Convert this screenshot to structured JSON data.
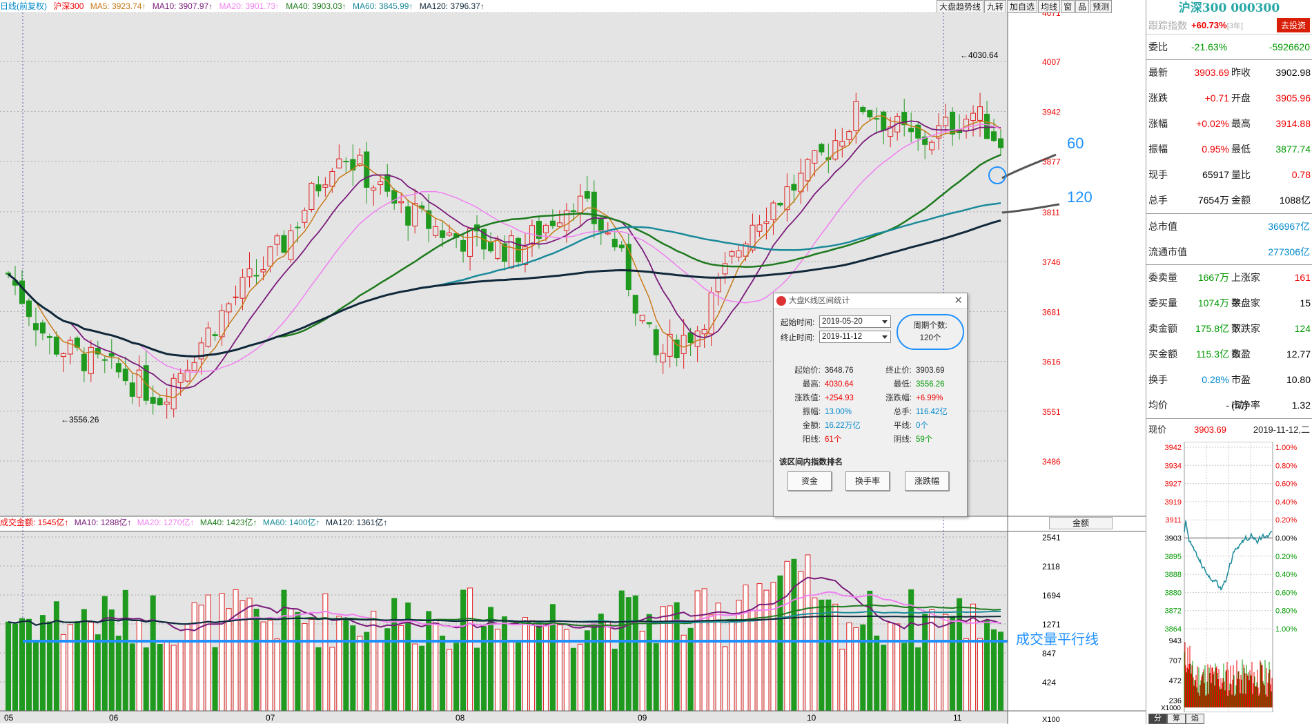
{
  "legend_main": {
    "title": "日线(前复权)",
    "index": "沪深300",
    "ma5": "MA5: 3923.74↑",
    "ma10": "MA10: 3907.97↑",
    "ma20": "MA20: 3901.73↑",
    "ma40": "MA40: 3903.03↑",
    "ma60": "MA60: 3845.99↑",
    "ma120": "MA120: 3796.37↑"
  },
  "toolbar": {
    "btn1": "大盘趋势线",
    "btn2": "九转",
    "btn3": "加自选",
    "btn4": "均线",
    "btn5": "窗",
    "btn6": "品",
    "btn7": "预测"
  },
  "legend_vol": {
    "title": "成交金额: 1545亿↑",
    "ma10": "MA10: 1288亿↑",
    "ma20": "MA20: 1270亿↑",
    "ma40": "MA40: 1423亿↑",
    "ma60": "MA60: 1400亿↑",
    "ma120": "MA120: 1361亿↑",
    "selector": "金额"
  },
  "price_axis": [
    "4071",
    "4007",
    "3942",
    "3877",
    "3811",
    "3746",
    "3681",
    "3616",
    "3551",
    "3486"
  ],
  "vol_axis": [
    "2541",
    "2118",
    "1694",
    "1271",
    "847",
    "424"
  ],
  "vol_unit": "X100",
  "month_labels": [
    "05",
    "06",
    "07",
    "08",
    "09",
    "10",
    "11"
  ],
  "high_marker": "4030.64",
  "low_marker": "3556.26",
  "annotations": {
    "a60": "60",
    "a120": "120",
    "vol_line": "成交量平行线"
  },
  "dialog": {
    "title": "大盘K线区间统计",
    "start_label": "起始时间:",
    "start": "2019-05-20",
    "end_label": "终止时间:",
    "end": "2019-11-12",
    "period_label": "周期个数:",
    "period": "120个",
    "stats": [
      [
        "起始价:",
        "3648.76",
        "终止价:",
        "3903.69"
      ],
      [
        "最高:",
        "4030.64",
        "最低:",
        "3556.26"
      ],
      [
        "涨跌值:",
        "+254.93",
        "涨跌幅:",
        "+6.99%"
      ],
      [
        "振幅:",
        "13.00%",
        "总手:",
        "116.42亿"
      ],
      [
        "金额:",
        "16.22万亿",
        "平线:",
        "0个"
      ],
      [
        "阳线:",
        "61个",
        "阴线:",
        "59个"
      ]
    ],
    "rank_label": "该区间内指数排名",
    "btn_fund": "资金",
    "btn_turn": "换手率",
    "btn_chg": "涨跌幅"
  },
  "panel": {
    "title": "沪深300 000300",
    "track_label": "跟踪指数",
    "track_val": "+60.73%",
    "track_years": "[3年]",
    "invest": "去投资",
    "weibi_l": "委比",
    "weibi_v": "-21.63%",
    "weibi_v2": "-5926620",
    "rows": [
      [
        "最新",
        "3903.69",
        "昨收",
        "3902.98"
      ],
      [
        "涨跌",
        "+0.71",
        "开盘",
        "3905.96"
      ],
      [
        "涨幅",
        "+0.02%",
        "最高",
        "3914.88"
      ],
      [
        "振幅",
        "0.95%",
        "最低",
        "3877.74"
      ],
      [
        "现手",
        "65917",
        "量比",
        "0.78"
      ],
      [
        "总手",
        "7654万",
        "金额",
        "1088亿"
      ]
    ],
    "mv_l": "总市值",
    "mv_v": "366967亿",
    "fmv_l": "流通市值",
    "fmv_v": "277306亿",
    "rows2": [
      [
        "委卖量",
        "1667万",
        "上涨家数",
        "161"
      ],
      [
        "委买量",
        "1074万",
        "平盘家数",
        "15"
      ],
      [
        "卖金额",
        "175.8亿",
        "下跌家数",
        "124"
      ],
      [
        "买金额",
        "115.3亿",
        "市盈",
        "12.77"
      ],
      [
        "换手",
        "0.28%",
        "市盈(动)",
        "10.80"
      ],
      [
        "均价",
        "-",
        "市净率",
        "1.32"
      ]
    ],
    "now_l": "现价",
    "now_v": "3903.69",
    "date": "2019-11-12,二",
    "mini_left": [
      "3942",
      "3934",
      "3927",
      "3919",
      "3911",
      "3903",
      "3895",
      "3888",
      "3880",
      "3872",
      "3864"
    ],
    "mini_right": [
      "1.00%",
      "0.80%",
      "0.60%",
      "0.40%",
      "0.20%",
      "0.00%",
      "0.20%",
      "0.40%",
      "0.60%",
      "0.80%",
      "1.00%"
    ],
    "mini_vol": [
      "943",
      "707",
      "472",
      "236"
    ],
    "mini_unit": "X1000",
    "tabs": [
      "分",
      "筹",
      "焰"
    ]
  },
  "colors": {
    "up": "#e02020",
    "down": "#1f9a1f",
    "ma5": "#c87a1a",
    "ma10": "#7a1a7a",
    "ma20": "#f080f0",
    "ma40": "#1e7a1e",
    "ma60": "#1a8a9a",
    "ma120": "#10283a"
  }
}
